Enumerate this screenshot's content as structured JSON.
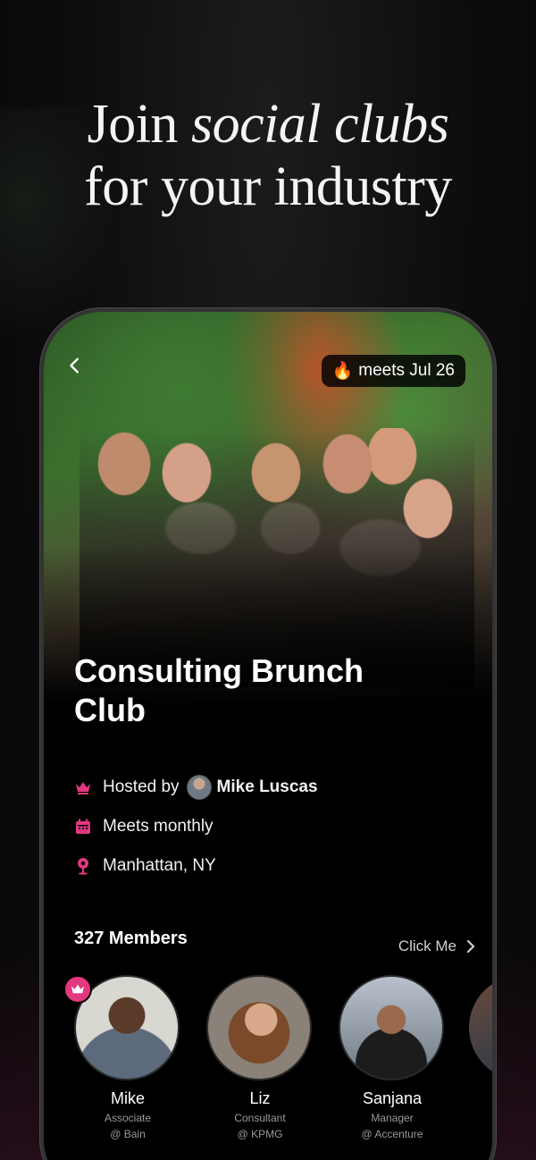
{
  "headline": {
    "line1_plain": "Join ",
    "line1_italic": "social clubs",
    "line2": "for your industry"
  },
  "club": {
    "meets_badge": "meets Jul 26",
    "meets_emoji": "🔥",
    "title": "Consulting Brunch Club",
    "hosted_by_label": "Hosted by",
    "host_name": "Mike Luscas",
    "frequency": "Meets monthly",
    "location": "Manhattan, NY"
  },
  "members": {
    "count_label": "327 Members",
    "click_me": "Click Me",
    "list": [
      {
        "name": "Mike",
        "role": "Associate",
        "company": "@ Bain",
        "host": true
      },
      {
        "name": "Liz",
        "role": "Consultant",
        "company": "@ KPMG",
        "host": false
      },
      {
        "name": "Sanjana",
        "role": "Manager",
        "company": "@ Accenture",
        "host": false
      }
    ]
  },
  "colors": {
    "accent": "#e2387f",
    "background": "#0c0c0c"
  },
  "icons": {
    "back": "chevron-left-icon",
    "host": "crown-icon",
    "frequency": "calendar-icon",
    "location": "map-pin-icon",
    "click_me": "chevron-right-icon"
  }
}
